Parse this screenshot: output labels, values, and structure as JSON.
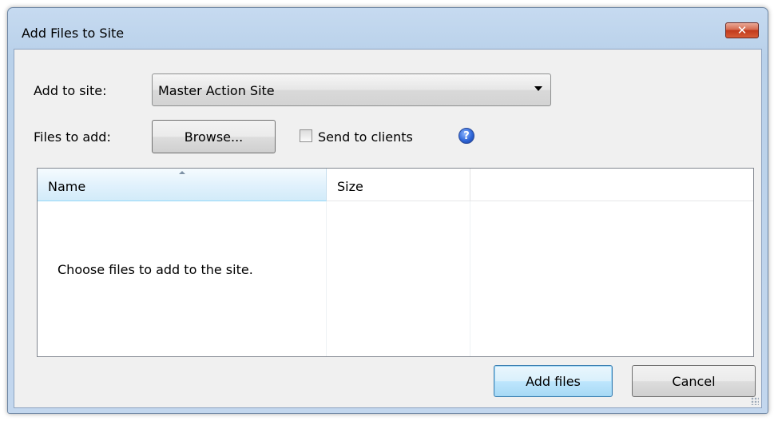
{
  "window": {
    "title": "Add Files to Site",
    "close_glyph": "✕"
  },
  "form": {
    "site_label": "Add to site:",
    "site_selected": "Master Action Site",
    "files_label": "Files to add:",
    "browse_label": "Browse...",
    "send_label": "Send to clients",
    "send_checked": false,
    "help_glyph": "?"
  },
  "list": {
    "columns": [
      {
        "label": "Name"
      },
      {
        "label": "Size"
      },
      {
        "label": ""
      }
    ],
    "sorted_column": "Name",
    "empty_message": "Choose files to add to the site."
  },
  "footer": {
    "add_label": "Add files",
    "cancel_label": "Cancel"
  },
  "icons": [
    "close-icon",
    "chevron-down-icon",
    "help-icon",
    "sort-ascending-icon",
    "resize-grip-icon"
  ],
  "colors": {
    "frame": "#b9d1ea",
    "close_button": "#c7432a",
    "dialog_body": "#f0f0f0",
    "default_button_border": "#3c7fb1"
  }
}
